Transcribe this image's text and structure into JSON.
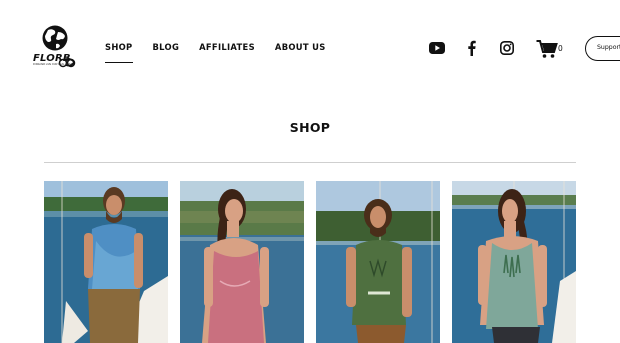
{
  "brand": {
    "name": "FLORB",
    "tagline": "FOREVER LIVE OUR REAL BLISS"
  },
  "nav": {
    "items": [
      {
        "label": "SHOP",
        "active": true
      },
      {
        "label": "BLOG",
        "active": false
      },
      {
        "label": "AFFILIATES",
        "active": false
      },
      {
        "label": "ABOUT US",
        "active": false
      }
    ]
  },
  "social": {
    "icons": [
      "youtube-icon",
      "facebook-icon",
      "instagram-icon"
    ]
  },
  "cart": {
    "count": "0"
  },
  "support": {
    "label": "Support"
  },
  "page": {
    "title": "SHOP"
  },
  "products": [
    {
      "shirt_color": "#4f8fc4",
      "pants": "#8a6a3c",
      "skin": "#c98e6b",
      "hair": "#5a3a22"
    },
    {
      "shirt_color": "#c9707f",
      "pants": "#c0457a",
      "skin": "#d8a184",
      "hair": "#3d2316"
    },
    {
      "shirt_color": "#4f7040",
      "pants": "#8c5a2e",
      "skin": "#c98e6b",
      "hair": "#4a2e1a"
    },
    {
      "shirt_color": "#7fa79a",
      "pants": "#2f3036",
      "skin": "#d8a184",
      "hair": "#3d2316"
    }
  ]
}
